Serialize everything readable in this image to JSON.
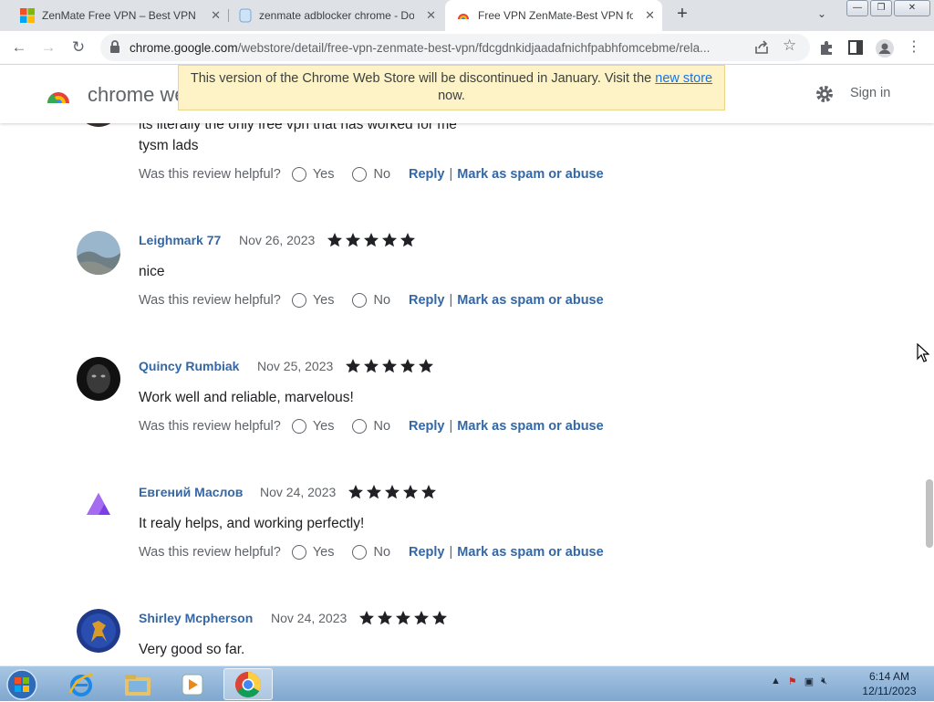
{
  "browser": {
    "tabs": [
      {
        "title": "ZenMate Free VPN – Best VPN fo",
        "active": false,
        "icon": "windows-logo-icon"
      },
      {
        "title": "zenmate adblocker chrome - Dog",
        "active": false,
        "icon": "page-icon"
      },
      {
        "title": "Free VPN ZenMate-Best VPN for",
        "active": true,
        "icon": "chrome-web-store-icon"
      }
    ],
    "url_main": "chrome.google.com",
    "url_rest": "/webstore/detail/free-vpn-zenmate-best-vpn/fdcgdnkidjaadafnichfpabhfomcebme/rela...",
    "icons": [
      "back-icon",
      "forward-icon",
      "reload-icon",
      "lock-icon",
      "share-icon",
      "star-icon",
      "extensions-icon",
      "side-panel-icon",
      "profile-icon",
      "menu-icon"
    ]
  },
  "header": {
    "store_title": "chrome web store",
    "sign_in": "Sign in"
  },
  "banner": {
    "text_before": "This version of the Chrome Web Store will be discontinued in January. Visit the ",
    "link_text": "new store",
    "text_after": " now."
  },
  "reviews": [
    {
      "name": "",
      "date": "",
      "text_partial": "its literally the only free vpn that has worked for me",
      "text": "tysm lads"
    },
    {
      "name": "Leighmark 77",
      "date": "Nov 26, 2023",
      "stars": 5,
      "text": "nice"
    },
    {
      "name": "Quincy Rumbiak",
      "date": "Nov 25, 2023",
      "stars": 5,
      "text": "Work well and reliable, marvelous!"
    },
    {
      "name": "Евгений Маслов",
      "date": "Nov 24, 2023",
      "stars": 5,
      "text": "It realy helps, and working perfectly!"
    },
    {
      "name": "Shirley Mcpherson",
      "date": "Nov 24, 2023",
      "stars": 5,
      "text": "Very good so far."
    }
  ],
  "review_actions": {
    "helpful": "Was this review helpful?",
    "yes": "Yes",
    "no": "No",
    "reply": "Reply",
    "spam": "Mark as spam or abuse"
  },
  "taskbar": {
    "time": "6:14 AM",
    "date": "12/11/2023",
    "apps": [
      "start-orb-icon",
      "internet-explorer-icon",
      "file-explorer-icon",
      "media-player-icon",
      "chrome-icon"
    ]
  },
  "colors": {
    "link": "#3367a6",
    "banner_bg": "#fdf3c6",
    "star": "#202124"
  }
}
